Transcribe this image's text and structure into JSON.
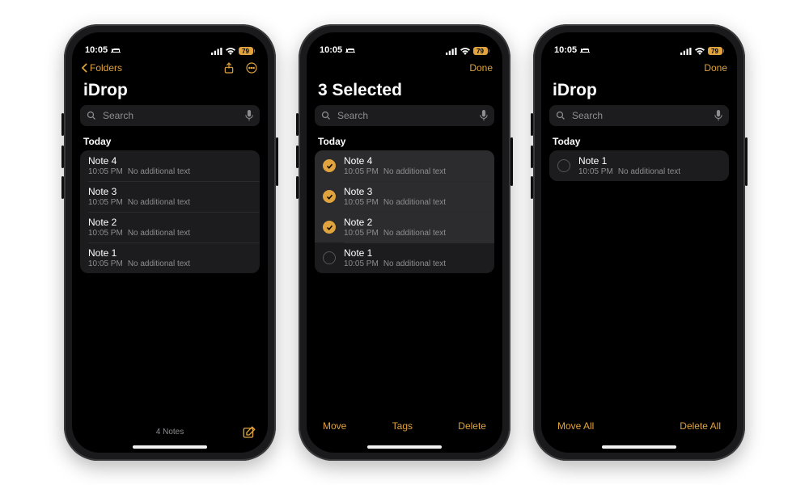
{
  "colors": {
    "accent": "#e0a33e"
  },
  "status": {
    "time": "10:05",
    "battery_pct": "79"
  },
  "search": {
    "placeholder": "Search"
  },
  "phone1": {
    "back_label": "Folders",
    "title": "iDrop",
    "section": "Today",
    "footer_count": "4 Notes",
    "notes": [
      {
        "title": "Note 4",
        "time": "10:05 PM",
        "subtitle": "No additional text"
      },
      {
        "title": "Note 3",
        "time": "10:05 PM",
        "subtitle": "No additional text"
      },
      {
        "title": "Note 2",
        "time": "10:05 PM",
        "subtitle": "No additional text"
      },
      {
        "title": "Note 1",
        "time": "10:05 PM",
        "subtitle": "No additional text"
      }
    ]
  },
  "phone2": {
    "done_label": "Done",
    "title": "3 Selected",
    "section": "Today",
    "actions": {
      "move": "Move",
      "tags": "Tags",
      "delete": "Delete"
    },
    "notes": [
      {
        "title": "Note 4",
        "time": "10:05 PM",
        "subtitle": "No additional text",
        "selected": true
      },
      {
        "title": "Note 3",
        "time": "10:05 PM",
        "subtitle": "No additional text",
        "selected": true
      },
      {
        "title": "Note 2",
        "time": "10:05 PM",
        "subtitle": "No additional text",
        "selected": true
      },
      {
        "title": "Note 1",
        "time": "10:05 PM",
        "subtitle": "No additional text",
        "selected": false
      }
    ]
  },
  "phone3": {
    "done_label": "Done",
    "title": "iDrop",
    "section": "Today",
    "actions": {
      "move_all": "Move All",
      "delete_all": "Delete All"
    },
    "notes": [
      {
        "title": "Note 1",
        "time": "10:05 PM",
        "subtitle": "No additional text",
        "selected": false
      }
    ]
  }
}
